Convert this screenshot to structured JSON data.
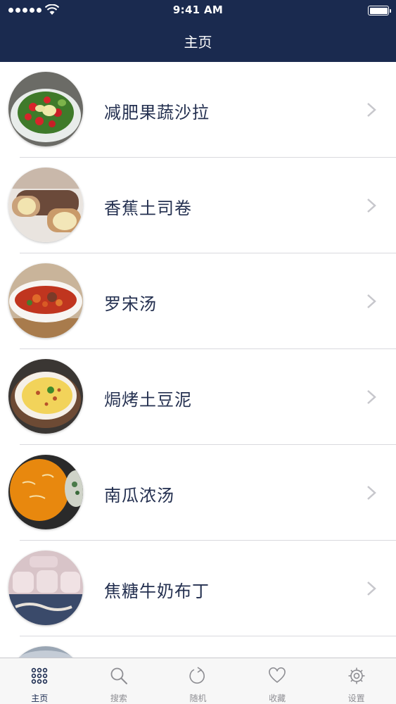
{
  "status_bar": {
    "time": "9:41 AM"
  },
  "header": {
    "title": "主页"
  },
  "recipes": [
    {
      "title": "减肥果蔬沙拉",
      "icon": "salad-photo"
    },
    {
      "title": "香蕉土司卷",
      "icon": "banana-roll-photo"
    },
    {
      "title": "罗宋汤",
      "icon": "borscht-photo"
    },
    {
      "title": "焗烤土豆泥",
      "icon": "baked-potato-photo"
    },
    {
      "title": "南瓜浓汤",
      "icon": "pumpkin-soup-photo"
    },
    {
      "title": "焦糖牛奶布丁",
      "icon": "caramel-pudding-photo"
    }
  ],
  "tabs": [
    {
      "label": "主页",
      "icon": "grid-icon",
      "active": true
    },
    {
      "label": "搜索",
      "icon": "search-icon",
      "active": false
    },
    {
      "label": "随机",
      "icon": "refresh-icon",
      "active": false
    },
    {
      "label": "收藏",
      "icon": "heart-icon",
      "active": false
    },
    {
      "label": "设置",
      "icon": "gear-icon",
      "active": false
    }
  ],
  "colors": {
    "nav_bar": "#1a2a4f",
    "active_tab": "#1a2a4f",
    "inactive_tab": "#8e8e93"
  }
}
